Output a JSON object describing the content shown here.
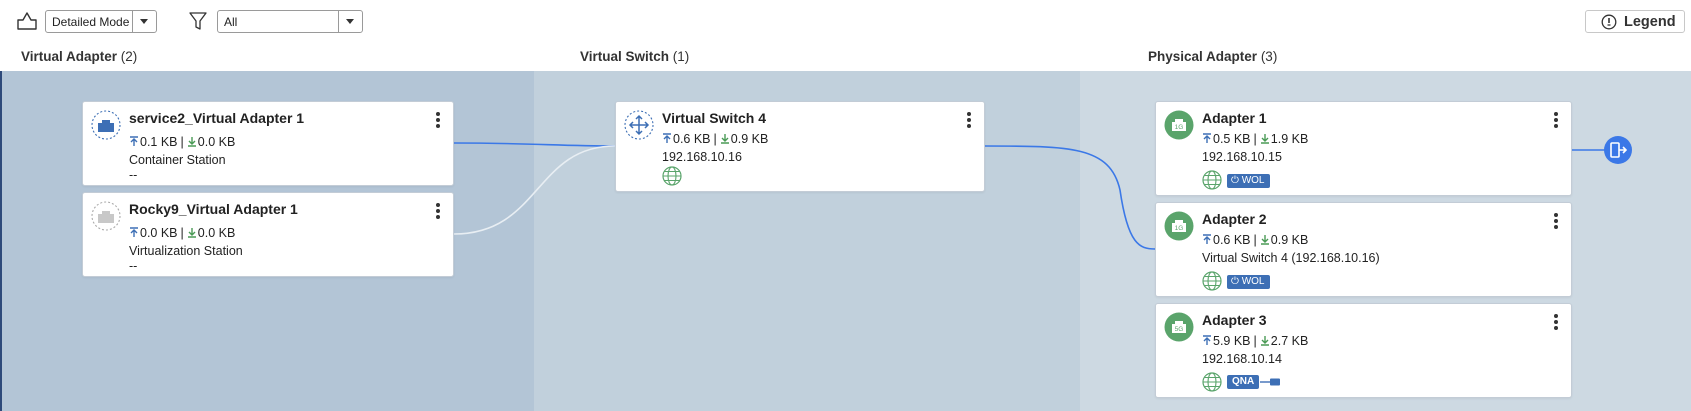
{
  "toolbar": {
    "view_mode": "Detailed Mode",
    "filter_value": "All",
    "legend_label": "Legend"
  },
  "columns": [
    {
      "label": "Virtual Adapter",
      "count": "(2)"
    },
    {
      "label": "Virtual Switch",
      "count": "(1)"
    },
    {
      "label": "Physical Adapter",
      "count": "(3)"
    }
  ],
  "virtual_adapters": [
    {
      "name": "service2_Virtual Adapter 1",
      "tx": "0.1 KB",
      "rx": "0.0 KB",
      "source": "Container Station",
      "ip": "--"
    },
    {
      "name": "Rocky9_Virtual Adapter 1",
      "tx": "0.0 KB",
      "rx": "0.0 KB",
      "source": "Virtualization Station",
      "ip": "--"
    }
  ],
  "virtual_switches": [
    {
      "name": "Virtual Switch 4",
      "tx": "0.6 KB",
      "rx": "0.9 KB",
      "ip": "192.168.10.16"
    }
  ],
  "physical_adapters": [
    {
      "name": "Adapter 1",
      "speed": "1G",
      "tx": "0.5 KB",
      "rx": "1.9 KB",
      "ip": "192.168.10.15",
      "tag": "WOL"
    },
    {
      "name": "Adapter 2",
      "speed": "1G",
      "tx": "0.6 KB",
      "rx": "0.9 KB",
      "ip": "Virtual Switch 4 (192.168.10.16)",
      "tag": "WOL"
    },
    {
      "name": "Adapter 3",
      "speed": "5G",
      "tx": "5.9 KB",
      "rx": "2.7 KB",
      "ip": "192.168.10.14",
      "tag": "QNA"
    }
  ],
  "traffic_separator": "|",
  "icons": {
    "layout": "home-outline-icon",
    "filter": "funnel-icon",
    "legend": "info-bulb-icon",
    "external": "external-port-icon"
  },
  "colors": {
    "accent": "#3d6fb5",
    "link_active": "#3b78e7",
    "adapter_green": "#5aa46b",
    "band_1": "#b3c5d6",
    "band_2": "#c1d0dc",
    "band_3": "#cdd9e2"
  }
}
